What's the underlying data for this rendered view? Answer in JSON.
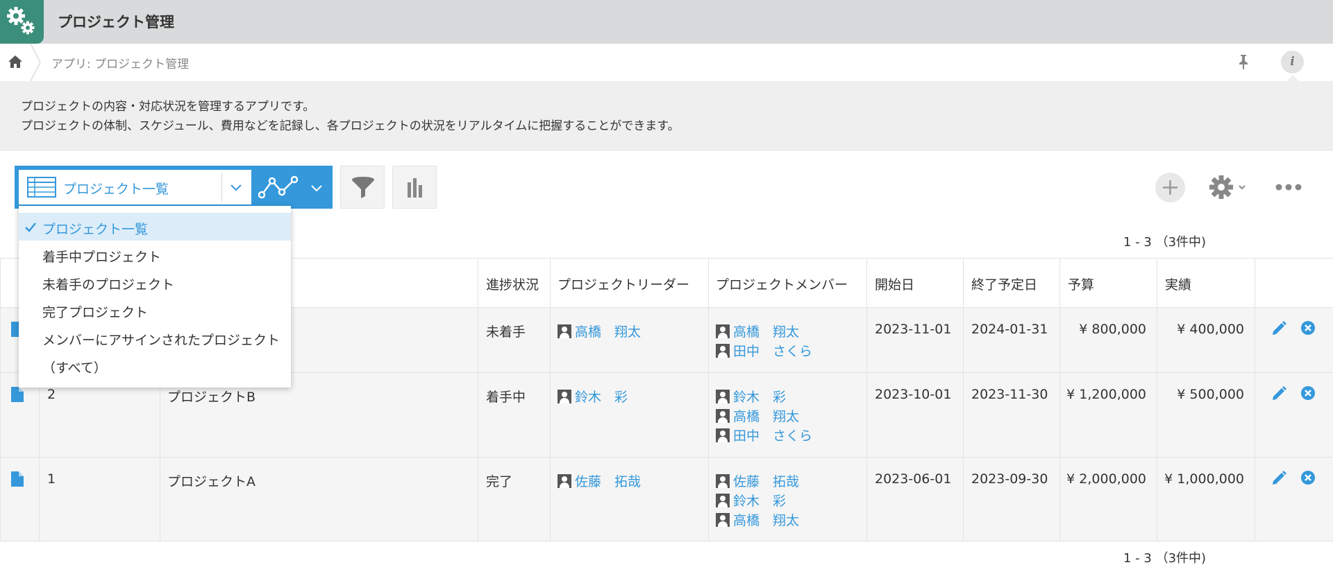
{
  "app": {
    "title": "プロジェクト管理"
  },
  "breadcrumb": {
    "text": "アプリ: プロジェクト管理"
  },
  "description": {
    "line1": "プロジェクトの内容・対応状況を管理するアプリです。",
    "line2": "プロジェクトの体制、スケジュール、費用などを記録し、各プロジェクトの状況をリアルタイムに把握することができます。"
  },
  "view_selector": {
    "current": "プロジェクト一覧"
  },
  "dropdown": {
    "items": [
      {
        "label": "プロジェクト一覧",
        "selected": true
      },
      {
        "label": "着手中プロジェクト"
      },
      {
        "label": "未着手のプロジェクト"
      },
      {
        "label": "完了プロジェクト"
      },
      {
        "label": "メンバーにアサインされたプロジェクト"
      },
      {
        "label": "（すべて）"
      }
    ]
  },
  "pagination": {
    "top": "1 - 3 （3件中)",
    "bottom": "1 - 3 （3件中)"
  },
  "table": {
    "headers": [
      "進捗状況",
      "プロジェクトリーダー",
      "プロジェクトメンバー",
      "開始日",
      "終了予定日",
      "予算",
      "実績"
    ],
    "rows": [
      {
        "id": "",
        "name": "",
        "status": "未着手",
        "leader": "高橋　翔太",
        "members": [
          "高橋　翔太",
          "田中　さくら"
        ],
        "start": "2023-11-01",
        "end": "2024-01-31",
        "budget": "¥ 800,000",
        "actual": "¥ 400,000"
      },
      {
        "id": "2",
        "name": "プロジェクトB",
        "status": "着手中",
        "leader": "鈴木　彩",
        "members": [
          "鈴木　彩",
          "高橋　翔太",
          "田中　さくら"
        ],
        "start": "2023-10-01",
        "end": "2023-11-30",
        "budget": "¥ 1,200,000",
        "actual": "¥ 500,000"
      },
      {
        "id": "1",
        "name": "プロジェクトA",
        "status": "完了",
        "leader": "佐藤　拓哉",
        "members": [
          "佐藤　拓哉",
          "鈴木　彩",
          "高橋　翔太"
        ],
        "start": "2023-06-01",
        "end": "2023-09-30",
        "budget": "¥ 2,000,000",
        "actual": "¥ 1,000,000"
      }
    ]
  },
  "colors": {
    "accent": "#3498db",
    "app_icon": "#3b8f7a",
    "delete": "#3498db"
  },
  "icons": [
    "gears-icon",
    "home-icon",
    "pin-icon",
    "info-icon",
    "list-view-icon",
    "chevron-down-icon",
    "graph-icon",
    "filter-icon",
    "bar-chart-icon",
    "plus-icon",
    "gear-icon",
    "more-icon",
    "document-icon",
    "pencil-icon",
    "delete-icon",
    "check-icon",
    "user-icon"
  ]
}
